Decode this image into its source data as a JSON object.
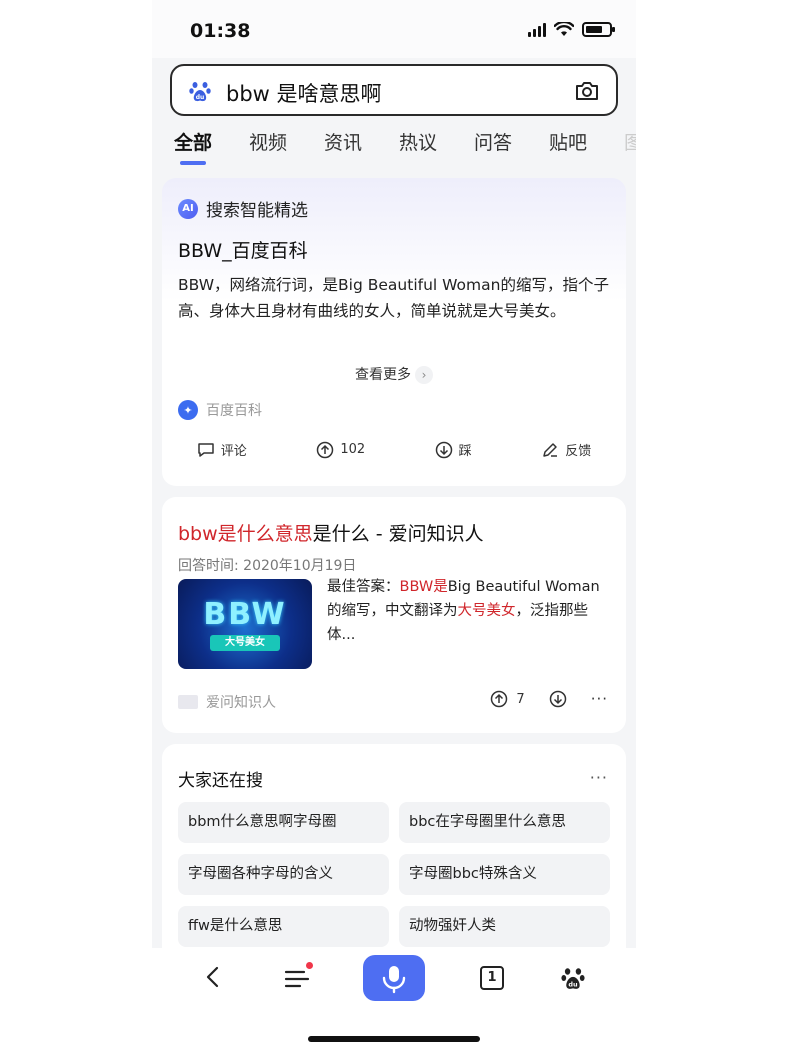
{
  "status_bar": {
    "time": "01:38"
  },
  "search": {
    "query": "bbw 是啥意思啊"
  },
  "tabs": [
    "全部",
    "视频",
    "资讯",
    "热议",
    "问答",
    "贴吧",
    "图"
  ],
  "ai_card": {
    "badge": "AI",
    "label": "搜索智能精选",
    "title": "BBW_百度百科",
    "body": "BBW，网络流行词，是Big Beautiful Woman的缩写，指个子高、身体大且身材有曲线的女人，简单说就是大号美女。",
    "more": "查看更多",
    "source": "百度百科",
    "actions": {
      "comment": "评论",
      "upvotes": "102",
      "down": "踩",
      "feedback": "反馈"
    }
  },
  "result_card": {
    "title_hl": "bbw是什么意思",
    "title_rest": "是什么 - 爱问知识人",
    "date": "回答时间: 2020年10月19日",
    "thumb_text": "BBW",
    "thumb_sub": "大号美女",
    "snip_prefix": "最佳答案：",
    "snip_red1": "BBW是",
    "snip_mid": "Big Beautiful Woman的缩写，中文翻译为",
    "snip_red2": "大号美女",
    "snip_end": "，泛指那些体...",
    "source": "爱问知识人",
    "upvotes": "7"
  },
  "related": {
    "title": "大家还在搜",
    "items": [
      "bbm什么意思啊字母圈",
      "bbc在字母圈里什么意思",
      "字母圈各种字母的含义",
      "字母圈bbc特殊含义",
      "ffw是什么意思",
      "动物强奸人类"
    ]
  },
  "nav": {
    "tab_count": "1"
  },
  "colors": {
    "accent": "#4e6ef2",
    "highlight": "#d0262b"
  }
}
